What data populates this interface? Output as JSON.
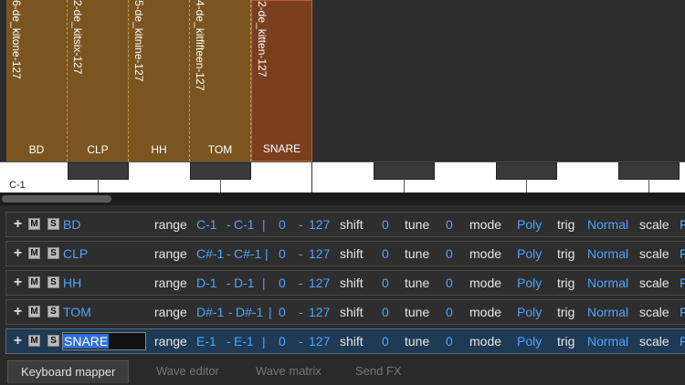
{
  "zones": [
    {
      "name": "6-de_kitone-127",
      "label": "BD"
    },
    {
      "name": "2-de_kitsix-127",
      "label": "CLP"
    },
    {
      "name": "5-de_kitnine-127",
      "label": "HH"
    },
    {
      "name": "4-de_kitfifteen-127",
      "label": "TOM"
    },
    {
      "name": "2-de_kitten-127",
      "label": "SNARE"
    }
  ],
  "keyboard": {
    "octave_label": "C-1"
  },
  "mapping_rows": [
    {
      "name": "BD",
      "range_label": "range",
      "range_from": "C-1",
      "range_to": "C-1",
      "vel_from": "0",
      "vel_to": "127",
      "shift_label": "shift",
      "shift": "0",
      "tune_label": "tune",
      "tune": "0",
      "mode_label": "mode",
      "mode": "Poly",
      "trig_label": "trig",
      "trig": "Normal",
      "scale_label": "scale",
      "scale": "F"
    },
    {
      "name": "CLP",
      "range_label": "range",
      "range_from": "C#-1",
      "range_to": "C#-1",
      "vel_from": "0",
      "vel_to": "127",
      "shift_label": "shift",
      "shift": "0",
      "tune_label": "tune",
      "tune": "0",
      "mode_label": "mode",
      "mode": "Poly",
      "trig_label": "trig",
      "trig": "Normal",
      "scale_label": "scale",
      "scale": "F"
    },
    {
      "name": "HH",
      "range_label": "range",
      "range_from": "D-1",
      "range_to": "D-1",
      "vel_from": "0",
      "vel_to": "127",
      "shift_label": "shift",
      "shift": "0",
      "tune_label": "tune",
      "tune": "0",
      "mode_label": "mode",
      "mode": "Poly",
      "trig_label": "trig",
      "trig": "Normal",
      "scale_label": "scale",
      "scale": "F"
    },
    {
      "name": "TOM",
      "range_label": "range",
      "range_from": "D#-1",
      "range_to": "D#-1",
      "vel_from": "0",
      "vel_to": "127",
      "shift_label": "shift",
      "shift": "0",
      "tune_label": "tune",
      "tune": "0",
      "mode_label": "mode",
      "mode": "Poly",
      "trig_label": "trig",
      "trig": "Normal",
      "scale_label": "scale",
      "scale": "F"
    },
    {
      "name": "SNARE",
      "range_label": "range",
      "range_from": "E-1",
      "range_to": "E-1",
      "vel_from": "0",
      "vel_to": "127",
      "shift_label": "shift",
      "shift": "0",
      "tune_label": "tune",
      "tune": "0",
      "mode_label": "mode",
      "mode": "Poly",
      "trig_label": "trig",
      "trig": "Normal",
      "scale_label": "scale",
      "scale": "F"
    }
  ],
  "row_buttons": {
    "add": "+",
    "mute": "M",
    "solo": "S"
  },
  "separator": "|",
  "dash": "-",
  "tabs": [
    "Keyboard mapper",
    "Wave editor",
    "Wave matrix",
    "Send FX"
  ],
  "colors": {
    "zone": "#7a5520",
    "zone_selected": "#7a3f1e",
    "value_blue": "#4fa3ff",
    "row_selected": "#1e3a55"
  }
}
